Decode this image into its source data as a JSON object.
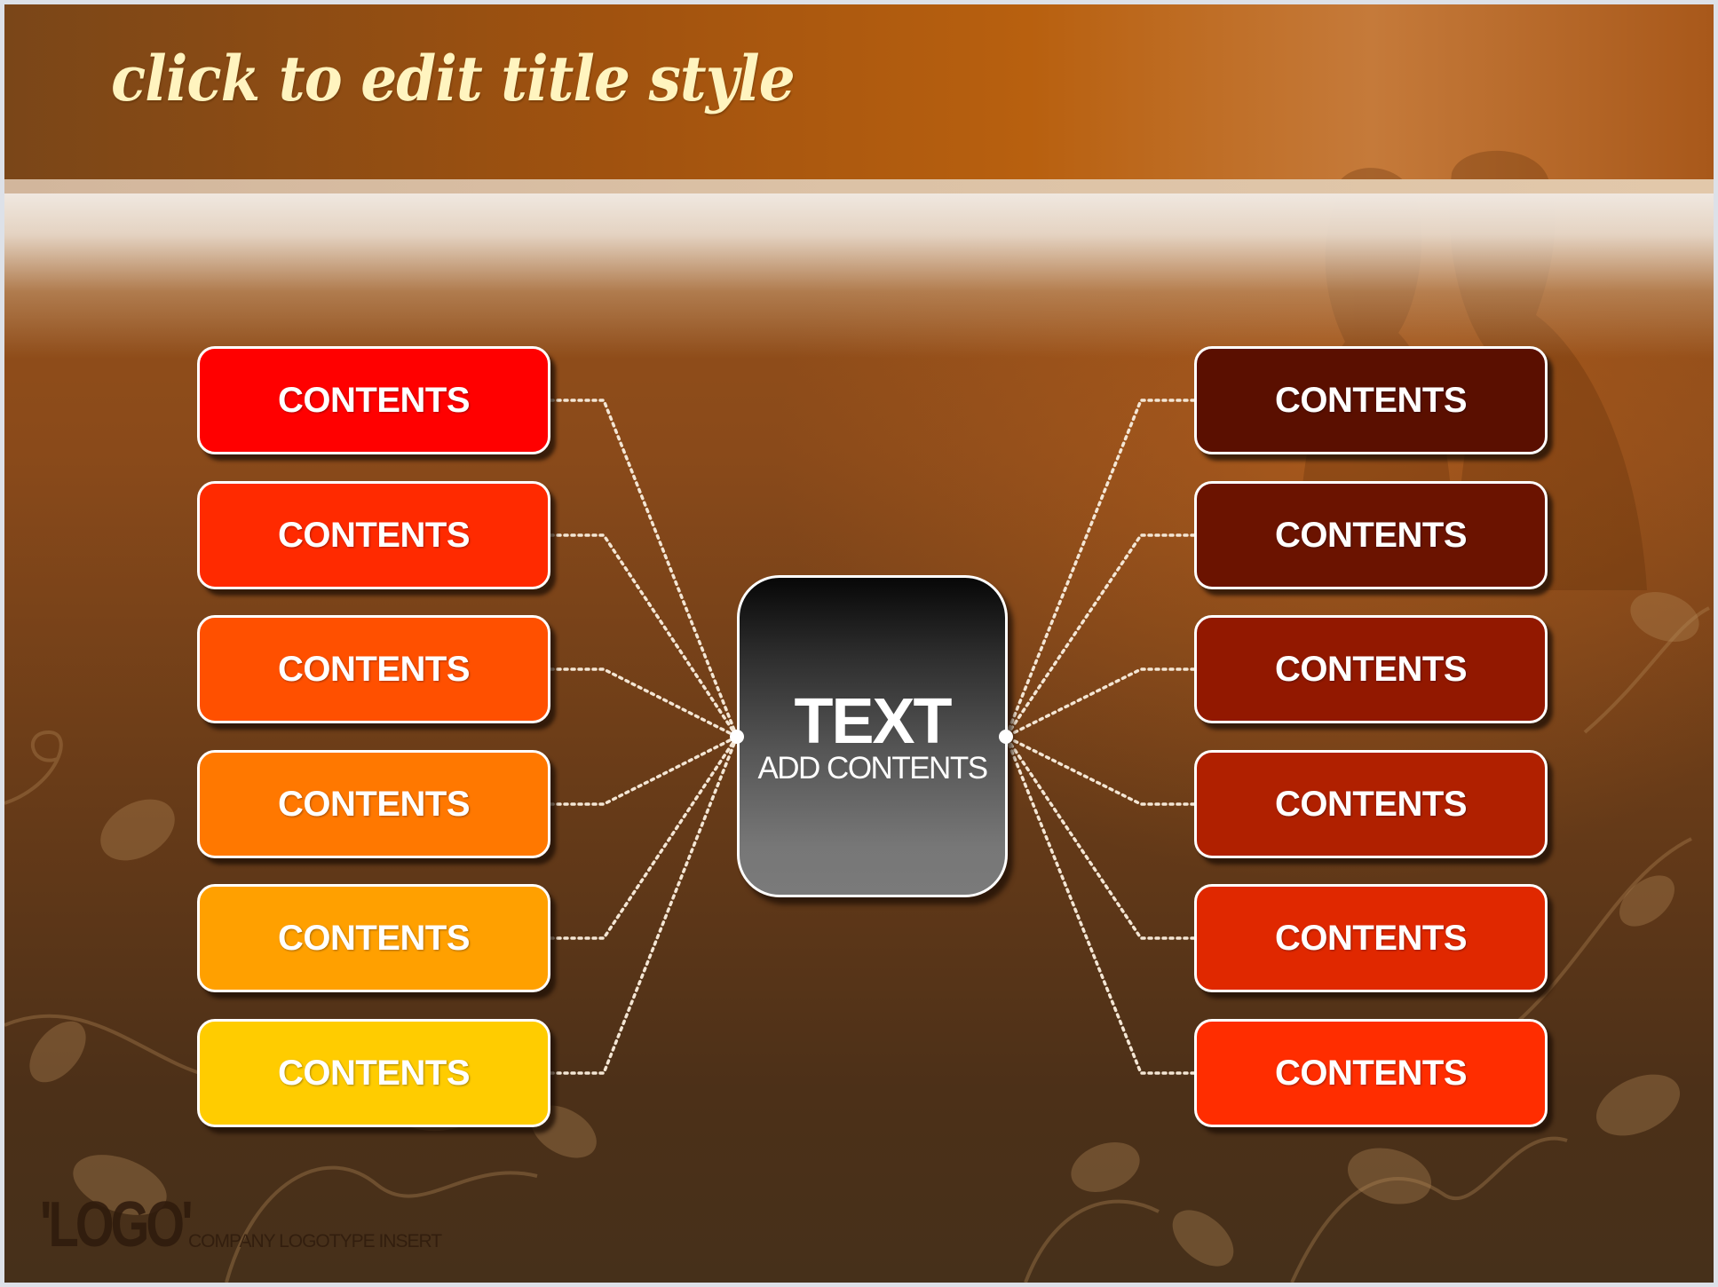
{
  "slide": {
    "title": "click to edit title style",
    "center": {
      "title": "TEXT",
      "subtitle": "ADD CONTENTS"
    },
    "left_items": [
      {
        "label": "CONTENTS",
        "color": "#ff0000"
      },
      {
        "label": "CONTENTS",
        "color": "#ff2a00"
      },
      {
        "label": "CONTENTS",
        "color": "#ff5000"
      },
      {
        "label": "CONTENTS",
        "color": "#ff7800"
      },
      {
        "label": "CONTENTS",
        "color": "#ffa000"
      },
      {
        "label": "CONTENTS",
        "color": "#ffcc00"
      }
    ],
    "right_items": [
      {
        "label": "CONTENTS",
        "color": "#5a0f00"
      },
      {
        "label": "CONTENTS",
        "color": "#6b1300"
      },
      {
        "label": "CONTENTS",
        "color": "#921800"
      },
      {
        "label": "CONTENTS",
        "color": "#b02000"
      },
      {
        "label": "CONTENTS",
        "color": "#e02800"
      },
      {
        "label": "CONTENTS",
        "color": "#ff2d00"
      }
    ],
    "logo": {
      "mark": "'LOGO'",
      "tagline": "COMPANY LOGOTYPE INSERT"
    }
  }
}
